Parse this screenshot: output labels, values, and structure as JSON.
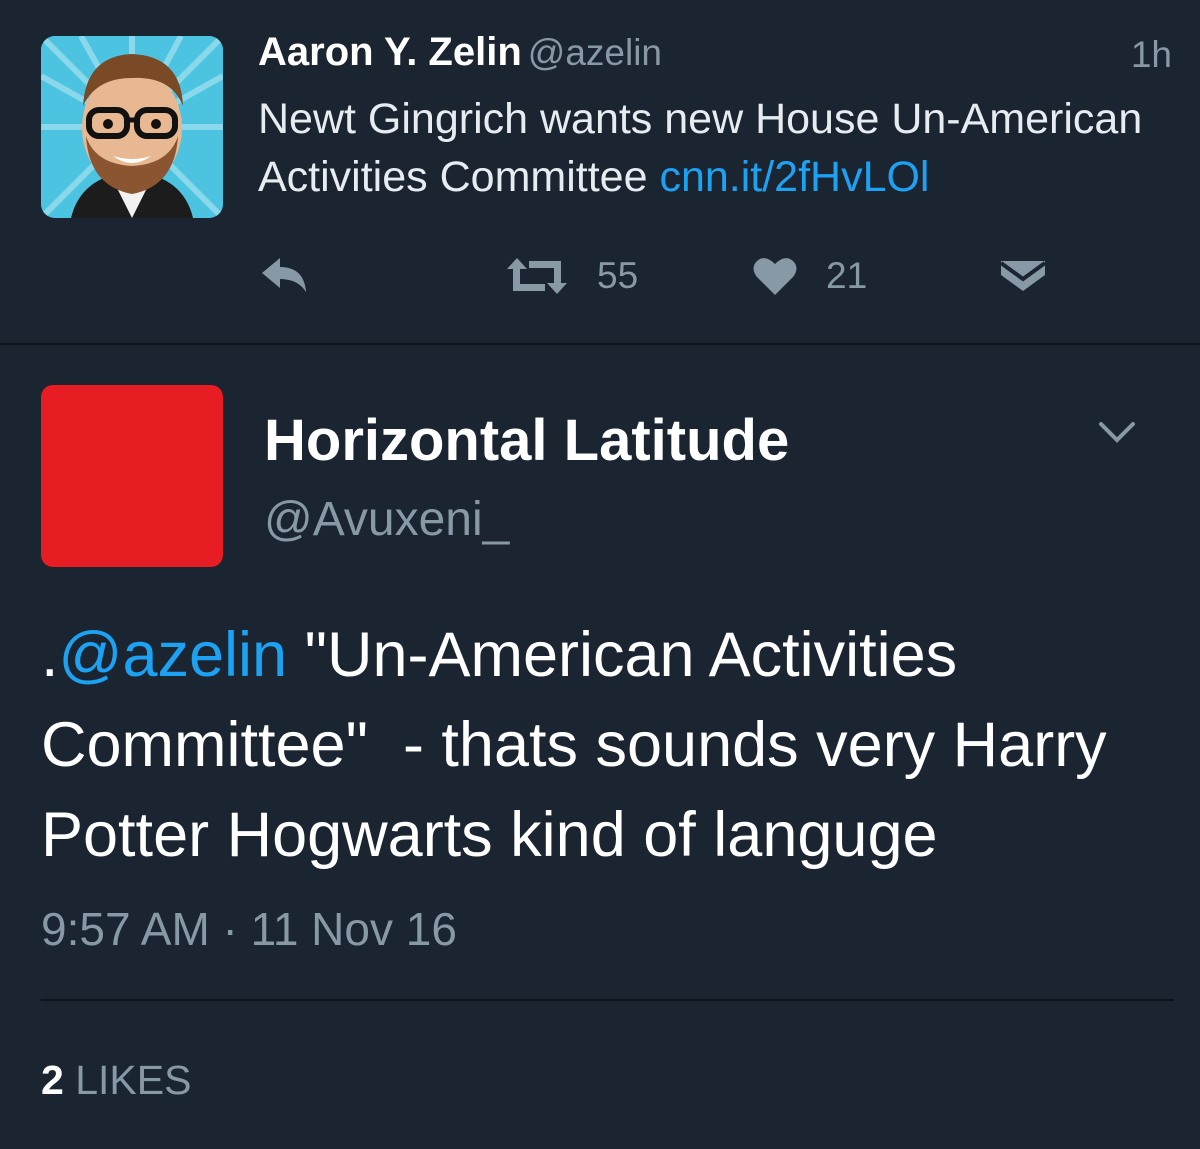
{
  "quoted_tweet": {
    "avatar": "cartoon-bearded-man-avatar",
    "name": "Aaron Y. Zelin",
    "handle": "@azelin",
    "time": "1h",
    "text": "Newt Gingrich wants new House Un-American Activities Committee",
    "link": "cnn.it/2fHvLOl",
    "actions": {
      "reply_icon": "reply-icon",
      "retweet_icon": "retweet-icon",
      "retweet_count": "55",
      "like_icon": "heart-icon",
      "like_count": "21",
      "dm_icon": "envelope-icon"
    }
  },
  "main_tweet": {
    "avatar_color": "#e81c23",
    "name": "Horizontal Latitude",
    "handle": "@Avuxeni_",
    "menu_icon": "chevron-down-icon",
    "prefix": ".",
    "mention": "@azelin",
    "text": " \"Un-American Activities Committee\"  - thats sounds very Harry Potter Hogwarts kind of languge",
    "timestamp": "9:57 AM · 11 Nov 16",
    "likes_count": "2",
    "likes_label": "LIKES"
  },
  "colors": {
    "background": "#1b2431",
    "muted": "#8899a6",
    "link": "#1da1f2"
  }
}
